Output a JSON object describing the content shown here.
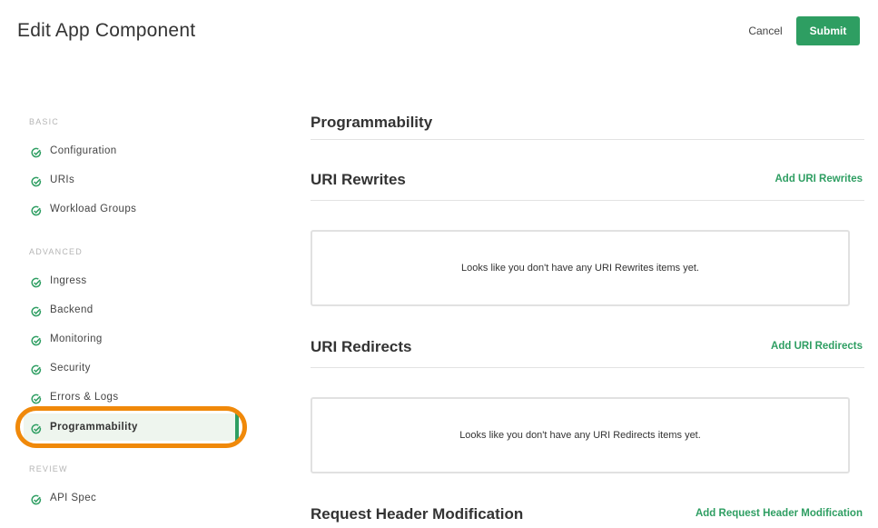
{
  "header": {
    "title": "Edit App Component",
    "cancel_label": "Cancel",
    "submit_label": "Submit"
  },
  "sidebar": {
    "sections": [
      {
        "label": "BASIC",
        "items": [
          "Configuration",
          "URIs",
          "Workload Groups"
        ]
      },
      {
        "label": "ADVANCED",
        "items": [
          "Ingress",
          "Backend",
          "Monitoring",
          "Security",
          "Errors & Logs",
          "Programmability"
        ]
      },
      {
        "label": "REVIEW",
        "items": [
          "API Spec"
        ]
      }
    ],
    "active_item": "Programmability",
    "check_icon": "check-circle-icon",
    "colors": {
      "accent": "#2e9e62",
      "highlight": "#f0890a",
      "active_bg": "#eef5ee"
    }
  },
  "main": {
    "title": "Programmability",
    "sections": [
      {
        "title": "URI Rewrites",
        "link": "Add URI Rewrites",
        "empty": "Looks like you don't have any URI Rewrites items yet."
      },
      {
        "title": "URI Redirects",
        "link": "Add URI Redirects",
        "empty": "Looks like you don't have any URI Redirects items yet."
      },
      {
        "title": "Request Header Modification",
        "link": "Add Request Header Modification"
      }
    ]
  }
}
